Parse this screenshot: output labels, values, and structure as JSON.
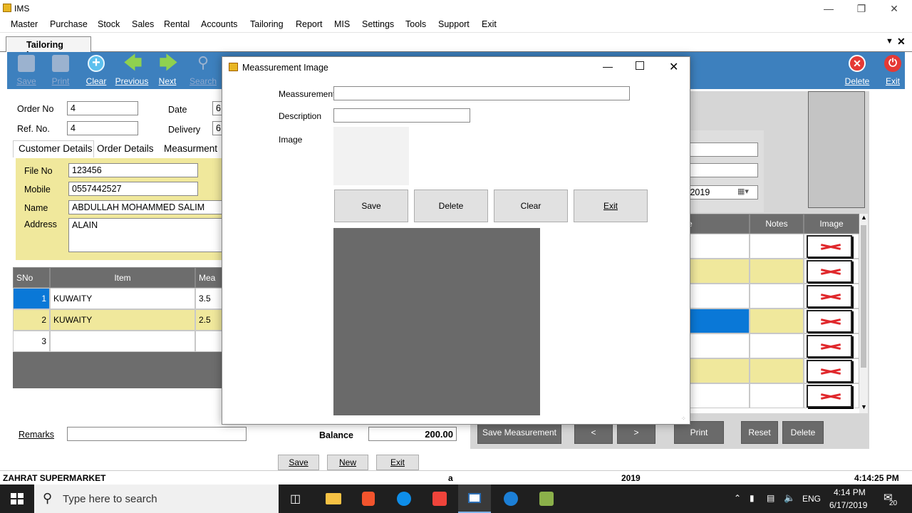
{
  "app": {
    "title": "IMS"
  },
  "menu": [
    "Master",
    "Purchase",
    "Stock",
    "Sales",
    "Rental",
    "Accounts",
    "Tailoring",
    "Report",
    "MIS",
    "Settings",
    "Tools",
    "Support",
    "Exit"
  ],
  "doc_tab": "Tailoring Invoce",
  "toolbar": {
    "left": [
      {
        "label": "Save",
        "icon": "save-icon",
        "enabled": false
      },
      {
        "label": "Print",
        "icon": "printer-icon",
        "enabled": false
      },
      {
        "label": "Clear",
        "icon": "plus-icon",
        "enabled": true
      },
      {
        "label": "Previous",
        "icon": "arrow-left-icon",
        "enabled": true
      },
      {
        "label": "Next",
        "icon": "arrow-right-icon",
        "enabled": true
      },
      {
        "label": "Search",
        "icon": "search-icon",
        "enabled": false
      }
    ],
    "right": [
      {
        "label": "Delete",
        "icon": "delete-icon"
      },
      {
        "label": "Exit",
        "icon": "power-icon"
      }
    ]
  },
  "order": {
    "order_no_label": "Order No",
    "order_no": "4",
    "ref_no_label": "Ref. No.",
    "ref_no": "4",
    "date_label": "Date",
    "date_value": "6",
    "delivery_label": "Delivery",
    "delivery_value": "6"
  },
  "tabs": [
    "Customer Details",
    "Order Details",
    "Measurment"
  ],
  "customer": {
    "file_no_label": "File No",
    "file_no": "123456",
    "mobile_label": "Mobile",
    "mobile": "0557442527",
    "name_label": "Name",
    "name": "ABDULLAH MOHAMMED SALIM",
    "address_label": "Address",
    "address": "ALAIN"
  },
  "items_grid": {
    "headers": [
      "SNo",
      "Item",
      "Mea"
    ],
    "rows": [
      {
        "sno": "1",
        "item": "KUWAITY",
        "mea": "3.5"
      },
      {
        "sno": "2",
        "item": "KUWAITY",
        "mea": "2.5"
      },
      {
        "sno": "3",
        "item": "",
        "mea": ""
      }
    ]
  },
  "right_panel": {
    "date_value": "/2019",
    "grid_headers": [
      "e",
      "Notes",
      "Image"
    ],
    "row_count": 7
  },
  "remarks_label": "Remarks",
  "balance_label": "Balance",
  "balance_value": "200.00",
  "bottom_buttons": [
    "Save Measurement",
    "<",
    ">",
    "Print",
    "Reset",
    "Delete"
  ],
  "footer_buttons": [
    "Save",
    "New",
    "Exit"
  ],
  "dialog": {
    "title": "Meassurement Image",
    "measurement_label": "Meassurement",
    "measurement_value": "",
    "description_label": "Description",
    "description_value": "",
    "image_label": "Image",
    "buttons": [
      "Save",
      "Delete",
      "Clear",
      "Exit"
    ]
  },
  "status": {
    "company": "ZAHRAT SUPERMARKET",
    "user": "a",
    "year": "2019",
    "time": "4:14:25 PM"
  },
  "taskbar": {
    "search_placeholder": "Type here to search",
    "lang": "ENG",
    "time": "4:14 PM",
    "date": "6/17/2019",
    "notifications": "20"
  }
}
